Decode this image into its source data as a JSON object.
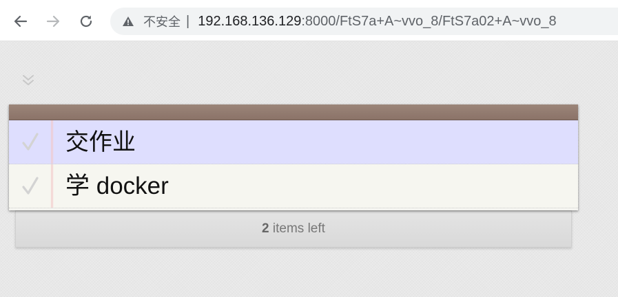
{
  "browser": {
    "security_label": "不安全",
    "separator": "|",
    "url_host": "192.168.136.129",
    "url_rest": ":8000/FtS7a+A~vvo_8/FtS7a02+A~vvo_8",
    "icons": {
      "back": "back-arrow-icon",
      "forward": "forward-arrow-icon",
      "reload": "reload-icon",
      "security": "warning-triangle-icon"
    }
  },
  "todos": {
    "toggle_all_icon": "double-chevron-down-icon",
    "items": [
      {
        "text": "交作业",
        "state": "editing"
      },
      {
        "text": "学 docker",
        "state": "normal"
      }
    ],
    "footer": {
      "count": "2",
      "count_suffix": " items left"
    },
    "colors": {
      "header": "#8b7368",
      "editing_row": "#dedefe",
      "row": "#f6f6f0",
      "margin_line": "#f3c7c7"
    }
  }
}
